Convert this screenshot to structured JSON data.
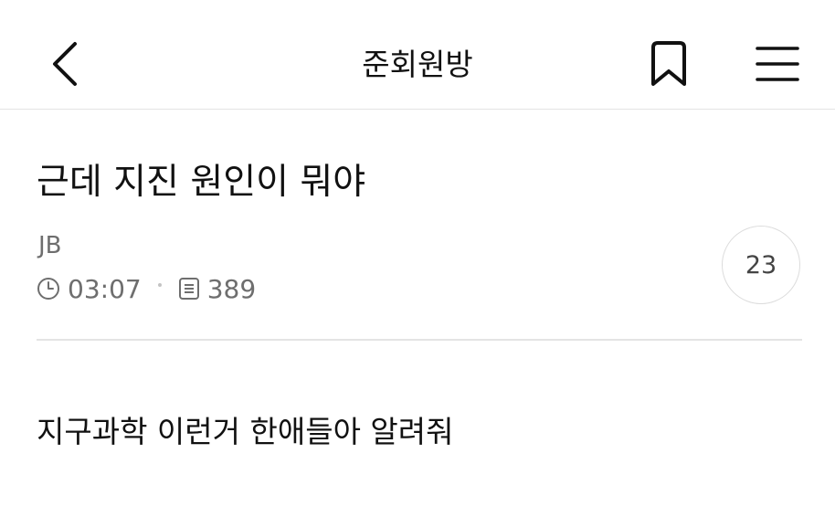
{
  "header": {
    "board_title": "준회원방",
    "back_icon": "chevron-left-icon",
    "bookmark_icon": "bookmark-icon",
    "menu_icon": "hamburger-menu-icon"
  },
  "post": {
    "title": "근데 지진 원인이 뭐야",
    "author": "JB",
    "time": "03:07",
    "views": "389",
    "comment_count": "23",
    "body": "지구과학 이런거 한애들아 알려줘"
  },
  "colors": {
    "text_primary": "#111111",
    "text_secondary": "#6e6e6e",
    "divider": "#e4e4e4"
  }
}
